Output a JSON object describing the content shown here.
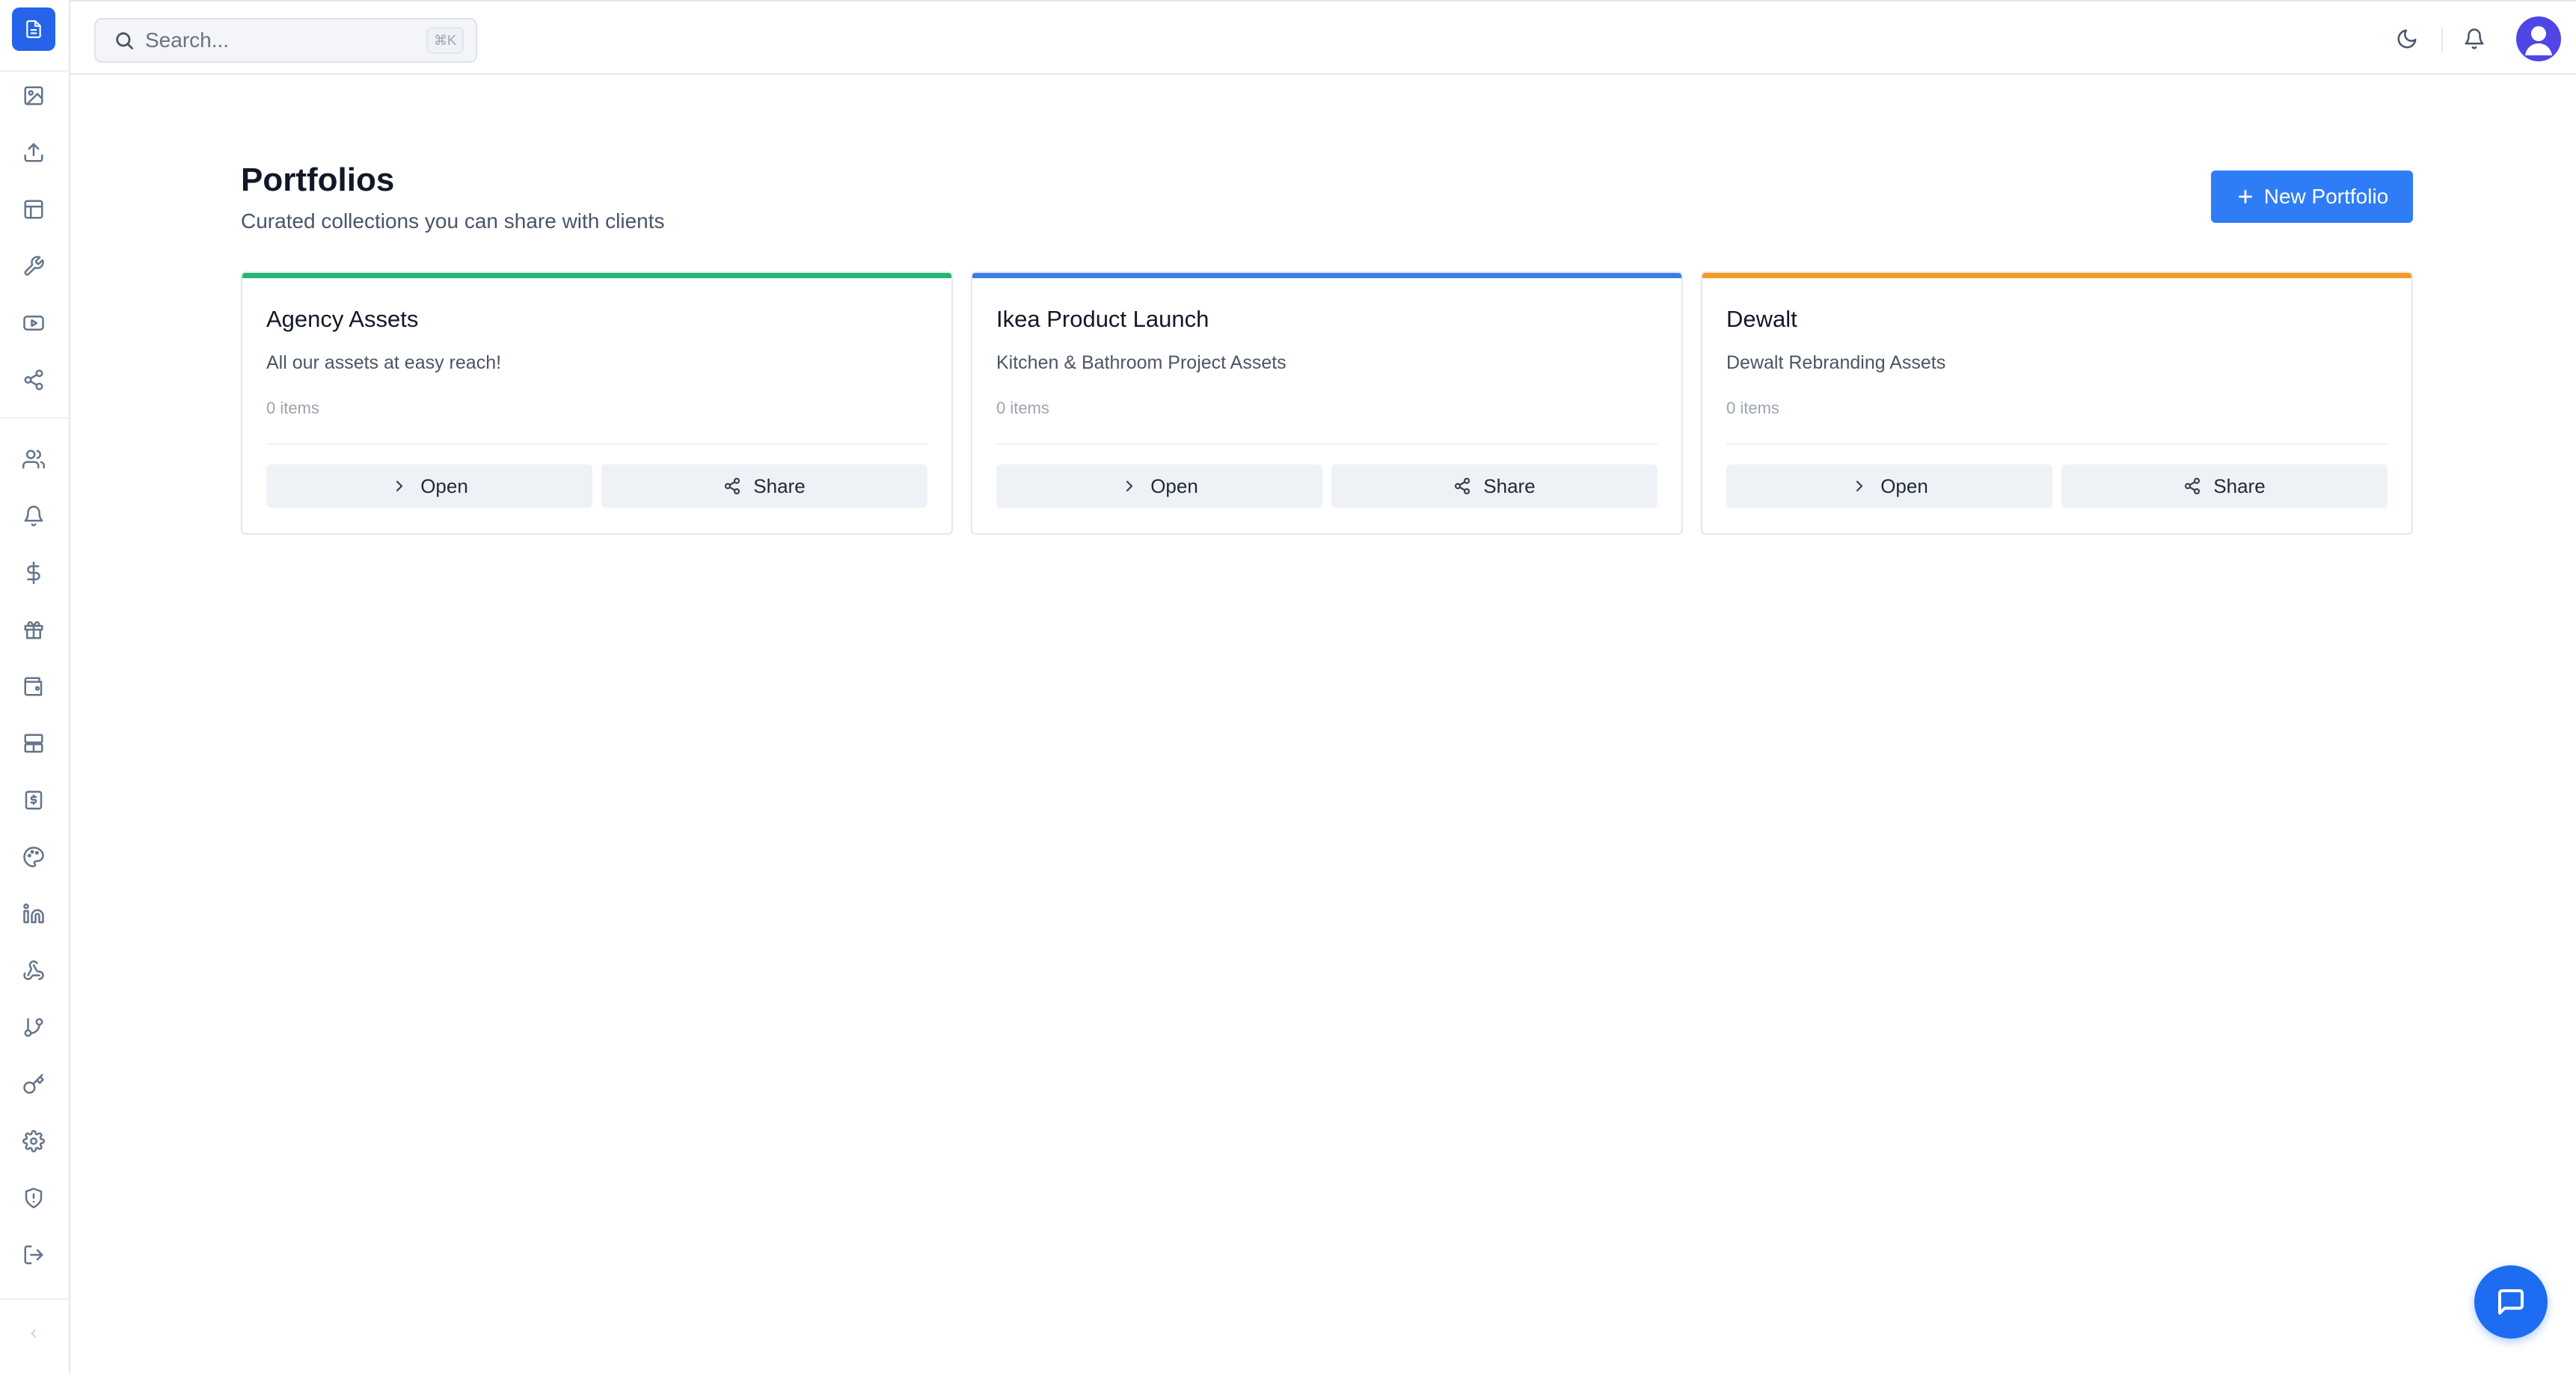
{
  "sidebar": {
    "icons": [
      "document-icon",
      "image-icon",
      "upload-icon",
      "layout-icon",
      "wrench-icon",
      "video-icon",
      "share-nodes-icon",
      "users-icon",
      "bell-icon",
      "dollar-icon",
      "gift-icon",
      "wallet-icon",
      "server-icon",
      "invoice-icon",
      "palette-icon",
      "linkedin-icon",
      "webhook-icon",
      "git-branch-icon",
      "key-icon",
      "settings-icon",
      "shield-icon",
      "logout-icon"
    ]
  },
  "header": {
    "search_placeholder": "Search...",
    "search_shortcut": "⌘K"
  },
  "main": {
    "title": "Portfolios",
    "subtitle": "Curated collections you can share with clients",
    "new_button_label": "New Portfolio",
    "portfolios": [
      {
        "title": "Agency Assets",
        "description": "All our assets at easy reach!",
        "count": "0 items",
        "accent": "#22b573",
        "open_label": "Open",
        "share_label": "Share"
      },
      {
        "title": "Ikea Product Launch",
        "description": "Kitchen & Bathroom Project Assets",
        "count": "0 items",
        "accent": "#3b7de8",
        "open_label": "Open",
        "share_label": "Share"
      },
      {
        "title": "Dewalt",
        "description": "Dewalt Rebranding Assets",
        "count": "0 items",
        "accent": "#f59a23",
        "open_label": "Open",
        "share_label": "Share"
      }
    ]
  },
  "colors": {
    "primary": "#2f7df6",
    "chat": "#1d6cf2"
  }
}
